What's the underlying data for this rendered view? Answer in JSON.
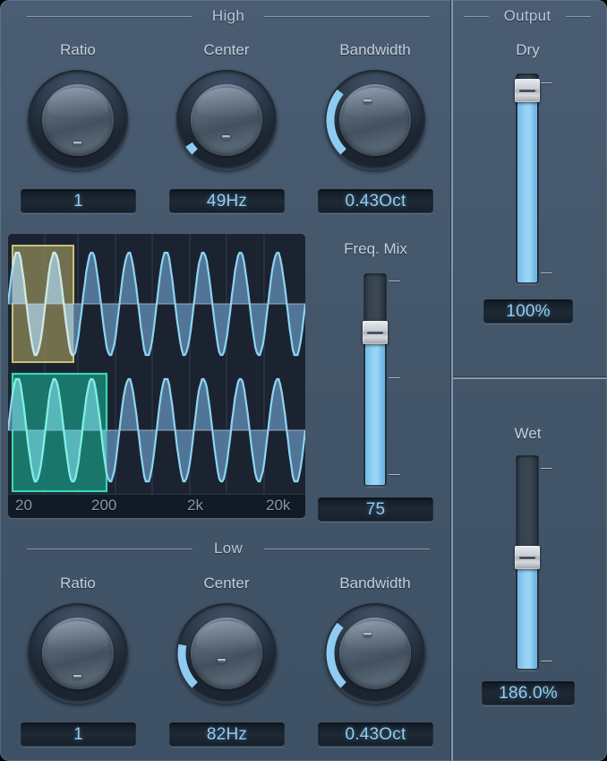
{
  "plugin": {
    "background_color": "#445669",
    "accent_color": "#8ecbf0"
  },
  "high_section": {
    "title": "High",
    "knobs": [
      {
        "label": "Ratio",
        "value": "1",
        "arc_start": 225,
        "arc_sweep": 0
      },
      {
        "label": "Center",
        "value": "49Hz",
        "arc_start": 225,
        "arc_sweep": 12
      },
      {
        "label": "Bandwidth",
        "value": "0.43Oct",
        "arc_start": 225,
        "arc_sweep": 84
      }
    ]
  },
  "low_section": {
    "title": "Low",
    "knobs": [
      {
        "label": "Ratio",
        "value": "1",
        "arc_start": 225,
        "arc_sweep": 0
      },
      {
        "label": "Center",
        "value": "82Hz",
        "arc_start": 225,
        "arc_sweep": 56
      },
      {
        "label": "Bandwidth",
        "value": "0.43Oct",
        "arc_start": 225,
        "arc_sweep": 84
      }
    ]
  },
  "freq_mix": {
    "label": "Freq. Mix",
    "value": "75",
    "fill_percent": 75
  },
  "output_section": {
    "title": "Output",
    "dry": {
      "label": "Dry",
      "value": "100%",
      "fill_percent": 97
    },
    "wet": {
      "label": "Wet",
      "value": "186.0%",
      "fill_percent": 53
    }
  },
  "spectrum_display": {
    "frequency_labels": [
      "20",
      "200",
      "2k",
      "20k"
    ],
    "high_band_selection": {
      "color": "#8a8557",
      "border_color": "#c9c07a",
      "x_start_pct": 1,
      "x_end_pct": 22,
      "label": "high-band-region"
    },
    "low_band_selection": {
      "color": "#1a8a7a",
      "border_color": "#3ad6ad",
      "x_start_pct": 1,
      "x_end_pct": 35,
      "label": "low-band-region"
    },
    "waveform_color": "#8fd4f2",
    "waveform_fill": "#5b84a8",
    "background_color": "#1b2331",
    "grid_color": "#2f3d4e",
    "top_wave_cycles": 8,
    "bottom_wave_cycles": 8
  }
}
